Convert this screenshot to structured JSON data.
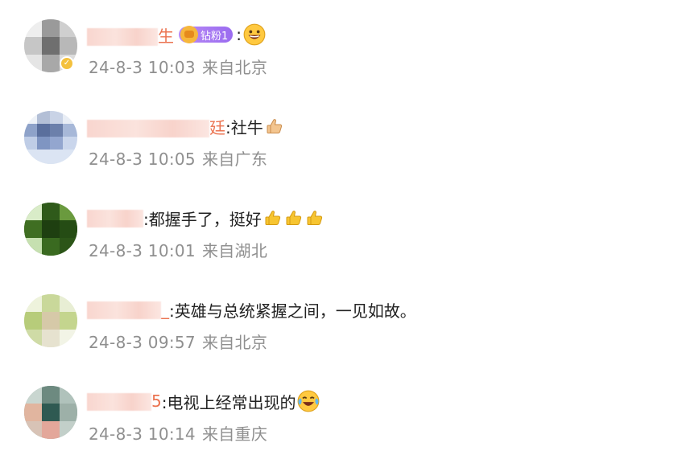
{
  "comments": [
    {
      "username_suffix": "生",
      "fan_badge": "钻粉1",
      "text": ":",
      "emoji": "grin-emoji",
      "time": "24-8-3 10:03",
      "location": "来自北京",
      "verified": true
    },
    {
      "username_suffix": "廷",
      "text": ":社牛",
      "emoji": "thumbs-up-emoji",
      "time": "24-8-3 10:05",
      "location": "来自广东"
    },
    {
      "username_suffix": "",
      "text": ":都握手了，挺好",
      "emoji": "thumbs-up-emoji-x3",
      "time": "24-8-3 10:01",
      "location": "来自湖北"
    },
    {
      "username_suffix": "_",
      "text": ":英雄与总统紧握之间，一见如故。",
      "time": "24-8-3 09:57",
      "location": "来自北京"
    },
    {
      "username_suffix": "5",
      "text": ":电视上经常出现的",
      "emoji": "laugh-cry-emoji",
      "time": "24-8-3 10:14",
      "location": "来自重庆"
    }
  ],
  "colors": {
    "username": "#eb7350",
    "meta": "#8f8f8f",
    "text": "#222222",
    "fan_badge": "#9a6bf0",
    "verified_badge": "#f4c13d"
  }
}
